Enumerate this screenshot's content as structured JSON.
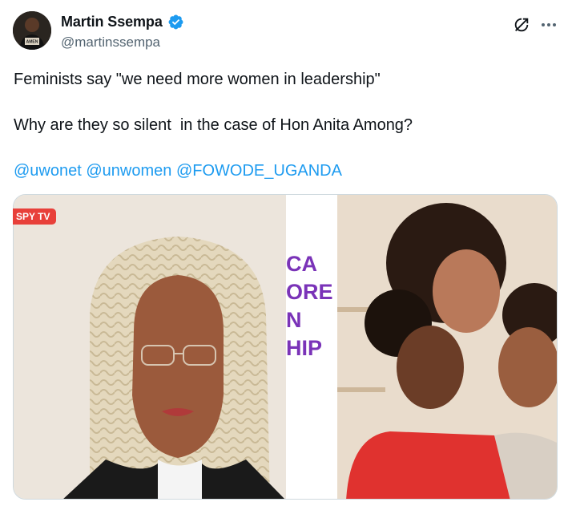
{
  "author": {
    "name": "Martin Ssempa",
    "handle": "@martinssempa",
    "verified_color": "#1d9bf0"
  },
  "actions": {
    "grok_icon": "grok-icon",
    "more_icon": "more-icon",
    "more_label": "···"
  },
  "tweet": {
    "line1": "Feminists say \"we need more women in leadership\"",
    "line2": "Why are they so silent  in the case of Hon Anita Among?",
    "mentions": [
      "@uwonet",
      "@unwomen",
      "@FOWODE_UGANDA"
    ],
    "mention_color": "#1d9bf0"
  },
  "media": {
    "badge": "SPY TV",
    "banner_lines": [
      "CA",
      "ORE",
      "N",
      "HIP"
    ],
    "banner_color": "#7a33b8"
  }
}
